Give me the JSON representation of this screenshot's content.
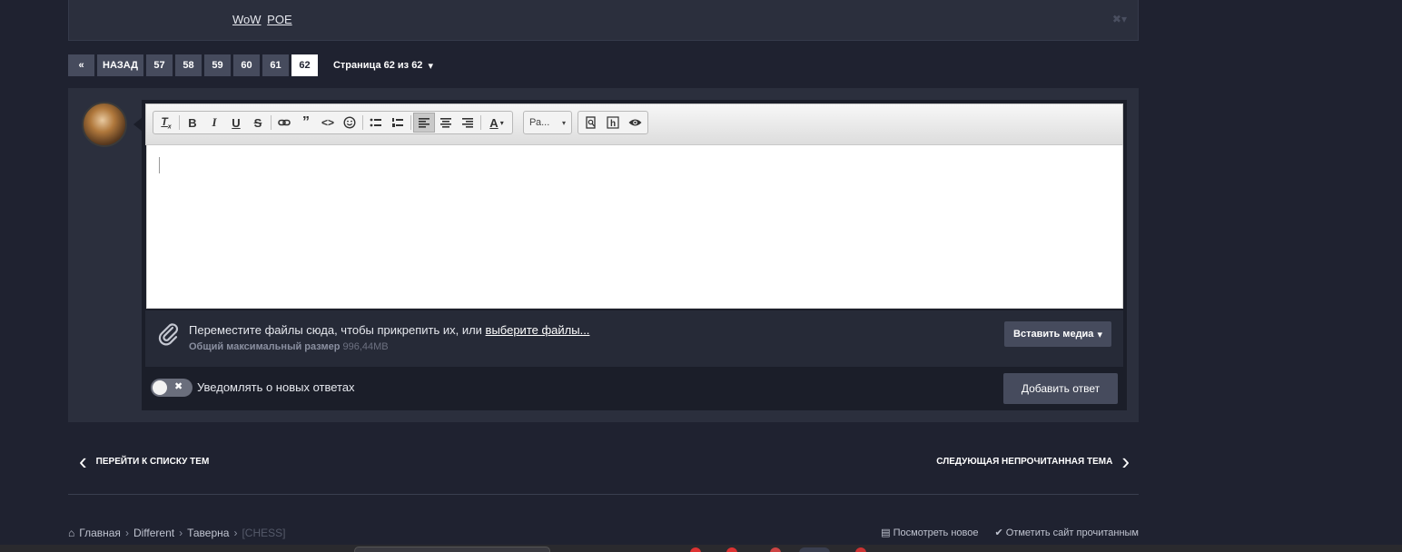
{
  "signature": {
    "links": [
      "WoW",
      "POE"
    ],
    "close_glyph": "✖▾"
  },
  "pagination": {
    "back_icon": "«",
    "back_label": "НАЗАД",
    "pages": [
      "57",
      "58",
      "59",
      "60",
      "61",
      "62"
    ],
    "current_page": "62",
    "page_count_label": "Страница 62 из 62",
    "page_count_caret": "▾"
  },
  "editor": {
    "toolbar": {
      "font_select_label": "Ра...",
      "font_select_caret": "▾",
      "color_caret": "▾"
    },
    "attach": {
      "text": "Переместите файлы сюда, чтобы прикрепить их, или ",
      "link": "выберите файлы...",
      "size_label": "Общий максимальный размер",
      "size_value": "996,44MB",
      "insert_media_label": "Вставить медиа",
      "insert_media_caret": "▾"
    },
    "notify_label": "Уведомлять о новых ответах",
    "toggle_glyph": "✖",
    "submit_label": "Добавить ответ"
  },
  "navigation": {
    "prev_label": "ПЕРЕЙТИ К СПИСКУ ТЕМ",
    "prev_icon": "‹",
    "next_label": "СЛЕДУЮЩАЯ НЕПРОЧИТАННАЯ ТЕМА",
    "next_icon": "›"
  },
  "breadcrumb": {
    "home_icon": "⌂",
    "items": [
      "Главная",
      "Different",
      "Таверна",
      "[CHESS]"
    ],
    "separator": "›"
  },
  "footer_actions": {
    "view_new_icon": "▤",
    "view_new": "Посмотреть новое",
    "mark_read_icon": "✔",
    "mark_read": "Отметить сайт прочитанным"
  }
}
